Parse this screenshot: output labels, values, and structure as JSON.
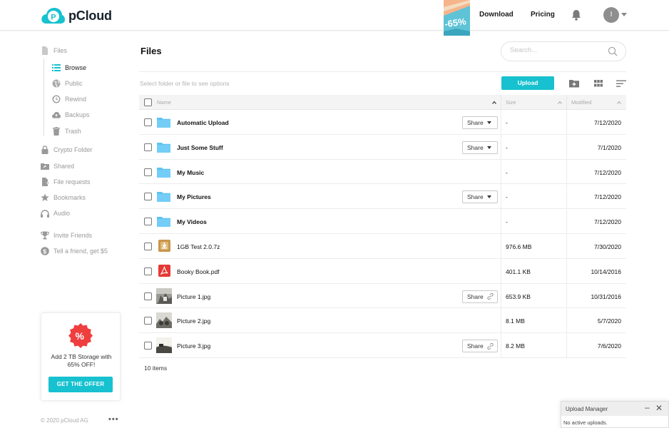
{
  "header": {
    "logo_text": "pCloud",
    "promo_badge": "-65%",
    "nav": [
      {
        "label": "Download"
      },
      {
        "label": "Pricing"
      }
    ],
    "avatar_initial": "I",
    "brand_color": "#17c1cf"
  },
  "sidebar": {
    "items": [
      {
        "label": "Files",
        "icon": "file-icon"
      },
      {
        "label": "Browse",
        "icon": "list-icon"
      },
      {
        "label": "Public",
        "icon": "globe-icon"
      },
      {
        "label": "Rewind",
        "icon": "history-icon"
      },
      {
        "label": "Backups",
        "icon": "cloud-upload-icon"
      },
      {
        "label": "Trash",
        "icon": "trash-icon"
      },
      {
        "label": "Crypto Folder",
        "icon": "lock-icon"
      },
      {
        "label": "Shared",
        "icon": "shared-folder-icon"
      },
      {
        "label": "File requests",
        "icon": "file-request-icon"
      },
      {
        "label": "Bookmarks",
        "icon": "star-icon"
      },
      {
        "label": "Audio",
        "icon": "headphones-icon"
      },
      {
        "label": "Invite Friends",
        "icon": "trophy-icon"
      },
      {
        "label": "Tell a friend, get $5",
        "icon": "dollar-icon"
      }
    ],
    "offer": {
      "text": "Add 2 TB Storage with 65% OFF!",
      "button": "GET THE OFFER"
    },
    "copyright": "© 2020 pCloud AG",
    "more": "•••"
  },
  "main": {
    "title": "Files",
    "search_placeholder": "Search...",
    "toolbar_hint": "Select folder or file to see options",
    "upload_label": "Upload",
    "columns": {
      "name": "Name",
      "size": "Size",
      "modified": "Modified"
    },
    "rows": [
      {
        "name": "Automatic Upload",
        "type": "folder",
        "size": "-",
        "modified": "7/12/2020",
        "share": "Share"
      },
      {
        "name": "Just Some Stuff",
        "type": "folder",
        "size": "-",
        "modified": "7/1/2020",
        "share": "Share"
      },
      {
        "name": "My Music",
        "type": "folder",
        "size": "-",
        "modified": "7/12/2020",
        "share": ""
      },
      {
        "name": "My Pictures",
        "type": "folder",
        "size": "-",
        "modified": "7/12/2020",
        "share": "Share"
      },
      {
        "name": "My Videos",
        "type": "folder",
        "size": "-",
        "modified": "7/12/2020",
        "share": ""
      },
      {
        "name": "1GB Test 2.0.7z",
        "type": "archive",
        "size": "976.6 MB",
        "modified": "7/30/2020",
        "share": ""
      },
      {
        "name": "Booky Book.pdf",
        "type": "pdf",
        "size": "401.1 KB",
        "modified": "10/14/2016",
        "share": ""
      },
      {
        "name": "Picture 1.jpg",
        "type": "image",
        "size": "653.9 KB",
        "modified": "10/31/2016",
        "share": "Share"
      },
      {
        "name": "Picture 2.jpg",
        "type": "image",
        "size": "8.1 MB",
        "modified": "5/7/2020",
        "share": ""
      },
      {
        "name": "Picture 3.jpg",
        "type": "image",
        "size": "8.2 MB",
        "modified": "7/6/2020",
        "share": "Share"
      }
    ],
    "items_count": "10 items"
  },
  "upload_manager": {
    "title": "Upload Manager",
    "status": "No active uploads."
  }
}
